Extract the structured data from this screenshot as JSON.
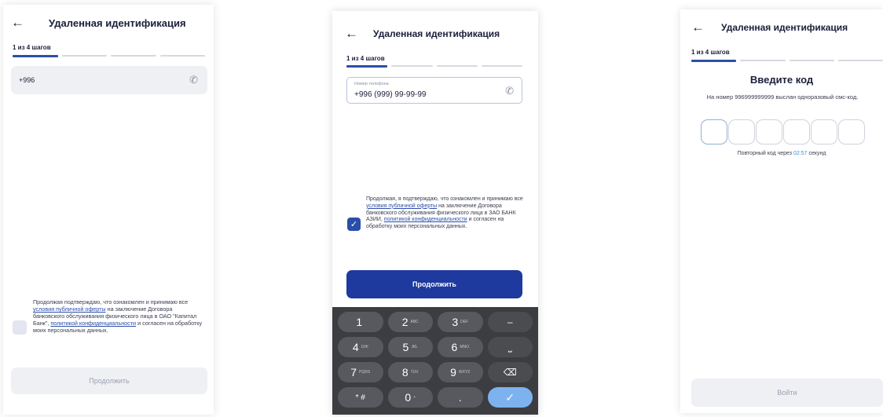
{
  "screen1": {
    "title": "Удаленная идентификация",
    "back_icon": "arrow-left-icon",
    "step_label": "1 из 4 шагов",
    "phone_value": "+996",
    "phone_icon": "phone-icon",
    "consent": {
      "part1": "Продолжая подтверждаю, что ознакомлен и принимаю все ",
      "link1": "условия публичной оферты",
      "part2": " на заключение Договора банковского обслуживания физического лица в ОАО \"Капитал Банк\", ",
      "link2": "политикой конфиденциальности",
      "part3": " и согласен на обработку моих персональных данных."
    },
    "checkbox_checked": false,
    "continue_label": "Продолжить"
  },
  "screen2": {
    "title": "Удаленная идентификация",
    "back_icon": "arrow-left-icon",
    "step_label": "1 из 4 шагов",
    "phone_placeholder": "Номер телефона",
    "phone_value": "+996 (999) 99-99-99",
    "phone_icon": "phone-icon",
    "consent": {
      "part1": "Продолжая, я подтверждаю, что ознакомлен и принимаю все ",
      "link1": "условия публичной оферты",
      "part2": " на заключение Договора банковского обслуживания физического лица в ЗАО БАНК АЗИИ, ",
      "link2": "политикой конфиденциальности",
      "part3": " и согласен на обработку моих персональных данных."
    },
    "checkbox_checked": true,
    "continue_label": "Продолжить",
    "keyboard": {
      "rows": [
        [
          {
            "main": "1",
            "sub": ""
          },
          {
            "main": "2",
            "sub": "ABC"
          },
          {
            "main": "3",
            "sub": "DEF"
          },
          {
            "main": "–",
            "sub": ""
          }
        ],
        [
          {
            "main": "4",
            "sub": "GHI"
          },
          {
            "main": "5",
            "sub": "JKL"
          },
          {
            "main": "6",
            "sub": "MNO"
          },
          {
            "main": "⎵",
            "sub": ""
          }
        ],
        [
          {
            "main": "7",
            "sub": "PQRS"
          },
          {
            "main": "8",
            "sub": "TUV"
          },
          {
            "main": "9",
            "sub": "WXYZ"
          },
          {
            "main": "⌫",
            "sub": ""
          }
        ],
        [
          {
            "main": "* #",
            "sub": ""
          },
          {
            "main": "0",
            "sub": "+"
          },
          {
            "main": ".",
            "sub": ""
          },
          {
            "main": "✓",
            "sub": ""
          }
        ]
      ]
    }
  },
  "screen3": {
    "title": "Удаленная идентификация",
    "back_icon": "arrow-left-icon",
    "step_label": "1 из 4 шагов",
    "code_title": "Введите код",
    "code_desc": "На номер 996999999999 выслан одноразовый смс-код.",
    "resend_prefix": "Повторный код через ",
    "resend_timer": "02:57",
    "resend_suffix": " секунд",
    "login_label": "Войти",
    "accent_color": "#3d8fd6"
  },
  "colors": {
    "primary": "#1e3a9e",
    "step_active": "#2b4ea8",
    "disabled_button": "#eff0f4"
  }
}
